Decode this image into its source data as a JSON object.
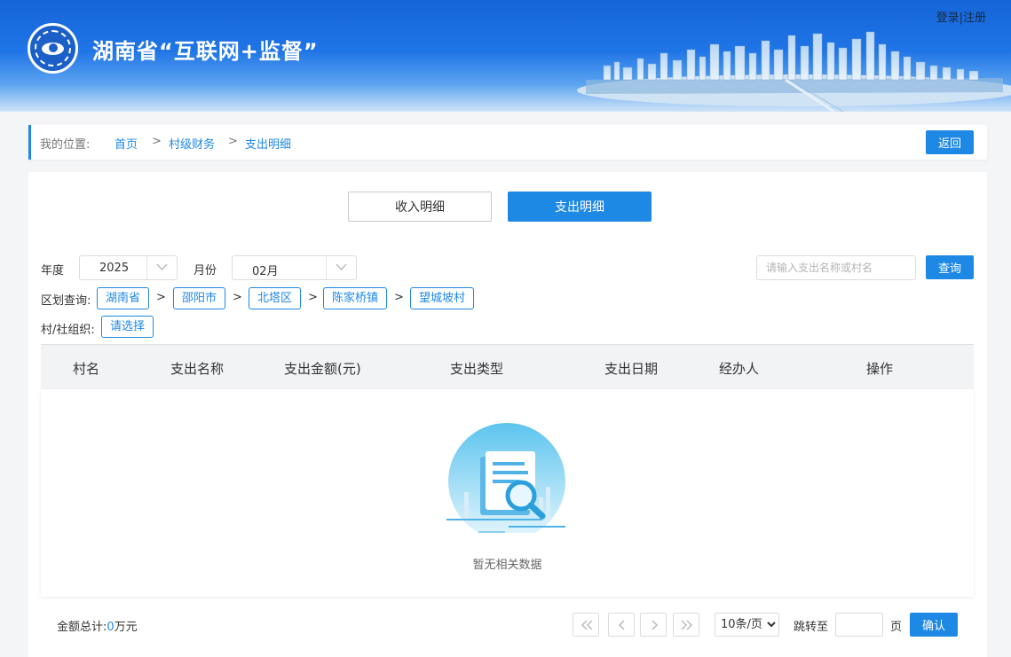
{
  "header": {
    "site_title": "湖南省“互联网+监督”",
    "login": "登录",
    "auth_divider": "|",
    "register": "注册"
  },
  "breadcrumb": {
    "label": "我的位置:",
    "items": [
      "首页",
      "村级财务",
      "支出明细"
    ],
    "separator": ">",
    "back_button": "返回"
  },
  "tabs": [
    {
      "label": "收入明细",
      "active": false
    },
    {
      "label": "支出明细",
      "active": true
    }
  ],
  "filters": {
    "year_label": "年度",
    "year_value": "2025",
    "month_label": "月份",
    "month_value": "02月",
    "search_placeholder": "请输入支出名称或村名",
    "search_value": "",
    "query_button": "查询",
    "region_label": "区划查询:",
    "region_path": [
      "湖南省",
      "邵阳市",
      "北塔区",
      "陈家桥镇",
      "望城坡村"
    ],
    "region_separator": ">",
    "org_label": "村/社组织:",
    "org_select": "请选择"
  },
  "table": {
    "columns": [
      "村名",
      "支出名称",
      "支出金额(元)",
      "支出类型",
      "支出日期",
      "经办人",
      "操作"
    ],
    "rows": [],
    "empty_text": "暂无相关数据"
  },
  "footer": {
    "total_label": "金额总计:",
    "total_value": "0",
    "total_unit": "万元",
    "page_size_options": [
      "10条/页"
    ],
    "page_size_selected": "10条/页",
    "jump_label": "跳转至",
    "jump_value": "",
    "page_unit": "页",
    "confirm_button": "确认"
  },
  "colors": {
    "primary": "#1e88e5",
    "header_dark": "#1565d8",
    "panel_bg": "#ffffff",
    "page_bg": "#f4f5f7"
  }
}
